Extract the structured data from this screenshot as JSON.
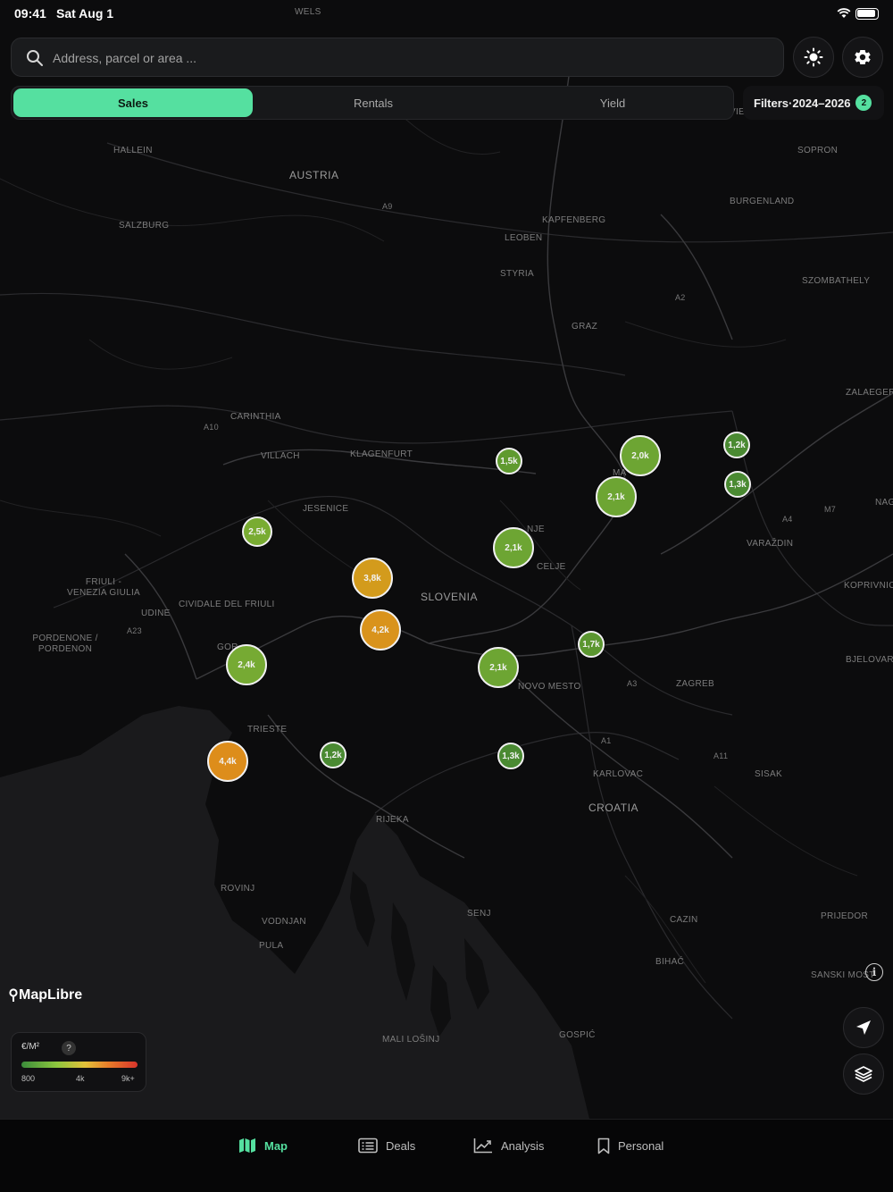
{
  "status": {
    "time": "09:41",
    "date": "Sat Aug 1"
  },
  "search": {
    "placeholder": "Address, parcel or area ..."
  },
  "tabs": [
    {
      "label": "Sales",
      "active": true
    },
    {
      "label": "Rentals",
      "active": false
    },
    {
      "label": "Yield",
      "active": false
    }
  ],
  "filters": {
    "label": "Filters",
    "range": "2024–2026",
    "count": "2"
  },
  "map": {
    "attribution": "MapLibre",
    "places": [
      {
        "name": "WELS",
        "type": "city"
      },
      {
        "name": "HALLEIN",
        "type": "city"
      },
      {
        "name": "AUSTRIA",
        "type": "country"
      },
      {
        "name": "SALZBURG",
        "type": "region"
      },
      {
        "name": "KAPFENBERG",
        "type": "city"
      },
      {
        "name": "LEOBEN",
        "type": "city"
      },
      {
        "name": "STYRIA",
        "type": "region"
      },
      {
        "name": "GRAZ",
        "type": "city"
      },
      {
        "name": "SOPRON",
        "type": "city"
      },
      {
        "name": "BURGENLAND",
        "type": "region"
      },
      {
        "name": "SZOMBATHELY",
        "type": "city"
      },
      {
        "name": "ZALAEGERS",
        "type": "city"
      },
      {
        "name": "CARINTHIA",
        "type": "region"
      },
      {
        "name": "VILLACH",
        "type": "city"
      },
      {
        "name": "KLAGENFURT",
        "type": "city"
      },
      {
        "name": "JESENICE",
        "type": "city"
      },
      {
        "name": "CELJE",
        "type": "city"
      },
      {
        "name": "VARAŽDIN",
        "type": "city"
      },
      {
        "name": "KOPRIVNICA",
        "type": "city"
      },
      {
        "name": "NAG",
        "type": "city"
      },
      {
        "name": "FRIULI - VENEZIA GIULIA",
        "type": "region"
      },
      {
        "name": "CIVIDALE DEL FRIULI",
        "type": "city"
      },
      {
        "name": "UDINE",
        "type": "city"
      },
      {
        "name": "SLOVENIA",
        "type": "country"
      },
      {
        "name": "PORDENONE / PORDENON",
        "type": "city"
      },
      {
        "name": "BJELOVAR",
        "type": "city"
      },
      {
        "name": "ZAGREB",
        "type": "city"
      },
      {
        "name": "NOVO MESTO",
        "type": "city"
      },
      {
        "name": "TRIESTE",
        "type": "city"
      },
      {
        "name": "KARLOVAC",
        "type": "city"
      },
      {
        "name": "SISAK",
        "type": "city"
      },
      {
        "name": "CROATIA",
        "type": "country"
      },
      {
        "name": "RIJEKA",
        "type": "city"
      },
      {
        "name": "ROVINJ",
        "type": "city"
      },
      {
        "name": "VODNJAN",
        "type": "city"
      },
      {
        "name": "PULA",
        "type": "city"
      },
      {
        "name": "SENJ",
        "type": "city"
      },
      {
        "name": "CAZIN",
        "type": "city"
      },
      {
        "name": "BIHAĆ",
        "type": "city"
      },
      {
        "name": "PRIJEDOR",
        "type": "city"
      },
      {
        "name": "SANSKI MOST",
        "type": "city"
      },
      {
        "name": "MALI LOŠINJ",
        "type": "city"
      },
      {
        "name": "GOSPIĆ",
        "type": "city"
      },
      {
        "name": "GOR",
        "type": "city"
      },
      {
        "name": "NJE",
        "type": "city"
      },
      {
        "name": "MA",
        "type": "city"
      },
      {
        "name": "VIE",
        "type": "city"
      },
      {
        "name": "A9",
        "type": "road"
      },
      {
        "name": "A2",
        "type": "road"
      },
      {
        "name": "A10",
        "type": "road"
      },
      {
        "name": "A23",
        "type": "road"
      },
      {
        "name": "A4",
        "type": "road"
      },
      {
        "name": "M7",
        "type": "road"
      },
      {
        "name": "A1",
        "type": "road"
      },
      {
        "name": "A3",
        "type": "road"
      },
      {
        "name": "A11",
        "type": "road"
      }
    ],
    "clusters": [
      {
        "label": "1,5k",
        "color": "#5f9a2f"
      },
      {
        "label": "2,0k",
        "color": "#6da533"
      },
      {
        "label": "1,2k",
        "color": "#4a8a32"
      },
      {
        "label": "1,3k",
        "color": "#4a8a32"
      },
      {
        "label": "2,1k",
        "color": "#6da533"
      },
      {
        "label": "2,5k",
        "color": "#79ac32"
      },
      {
        "label": "2,1k",
        "color": "#6da533"
      },
      {
        "label": "3,8k",
        "color": "#d39b1c"
      },
      {
        "label": "4,2k",
        "color": "#d9931c"
      },
      {
        "label": "1,7k",
        "color": "#5b9630"
      },
      {
        "label": "2,4k",
        "color": "#76aa33"
      },
      {
        "label": "2,1k",
        "color": "#6da533"
      },
      {
        "label": "1,2k",
        "color": "#4a8a32"
      },
      {
        "label": "1,3k",
        "color": "#4a8a32"
      },
      {
        "label": "4,4k",
        "color": "#dd8d1b"
      }
    ]
  },
  "legend": {
    "unit": "€/M²",
    "help": "?",
    "ticks": [
      "800",
      "4k",
      "9k+"
    ]
  },
  "nav": [
    {
      "label": "Map",
      "icon": "map-icon",
      "active": true
    },
    {
      "label": "Deals",
      "icon": "deals-icon",
      "active": false
    },
    {
      "label": "Analysis",
      "icon": "analysis-icon",
      "active": false
    },
    {
      "label": "Personal",
      "icon": "bookmark-icon",
      "active": false
    }
  ],
  "colors": {
    "accent": "#55e0a0",
    "background": "#0c0c0d"
  }
}
